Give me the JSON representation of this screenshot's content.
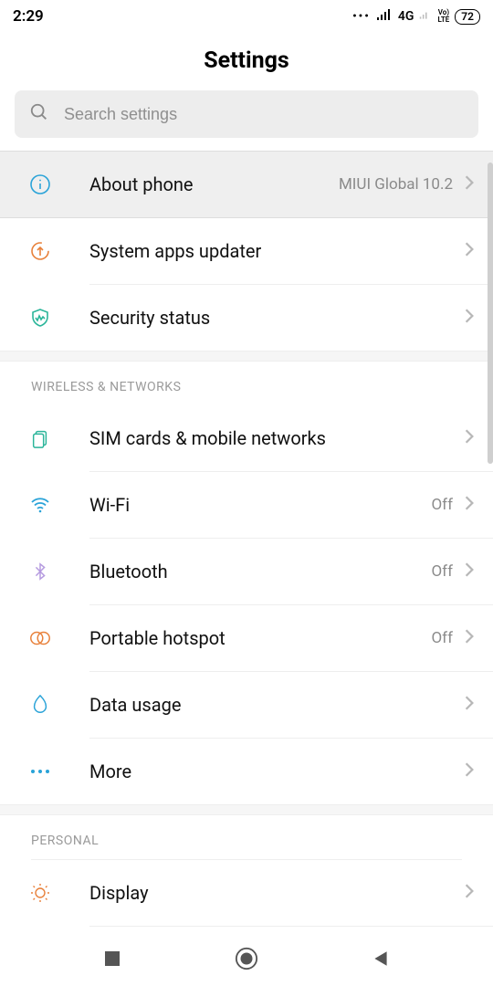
{
  "status": {
    "time": "2:29",
    "net": "4G",
    "volte": "Voℓ\nLTE",
    "battery": "72"
  },
  "title": "Settings",
  "search": {
    "placeholder": "Search settings"
  },
  "about": {
    "label": "About phone",
    "value": "MIUI Global 10.2"
  },
  "top_rows": [
    {
      "icon": "updater",
      "label": "System apps updater"
    },
    {
      "icon": "shield",
      "label": "Security status"
    }
  ],
  "sections": [
    {
      "header": "WIRELESS & NETWORKS",
      "rows": [
        {
          "icon": "sim",
          "label": "SIM cards & mobile networks",
          "value": ""
        },
        {
          "icon": "wifi",
          "label": "Wi-Fi",
          "value": "Off"
        },
        {
          "icon": "bluetooth",
          "label": "Bluetooth",
          "value": "Off"
        },
        {
          "icon": "hotspot",
          "label": "Portable hotspot",
          "value": "Off"
        },
        {
          "icon": "data",
          "label": "Data usage",
          "value": ""
        },
        {
          "icon": "more",
          "label": "More",
          "value": ""
        }
      ]
    },
    {
      "header": "PERSONAL",
      "rows": [
        {
          "icon": "display",
          "label": "Display",
          "value": ""
        }
      ]
    }
  ],
  "volte_label": "LTE"
}
